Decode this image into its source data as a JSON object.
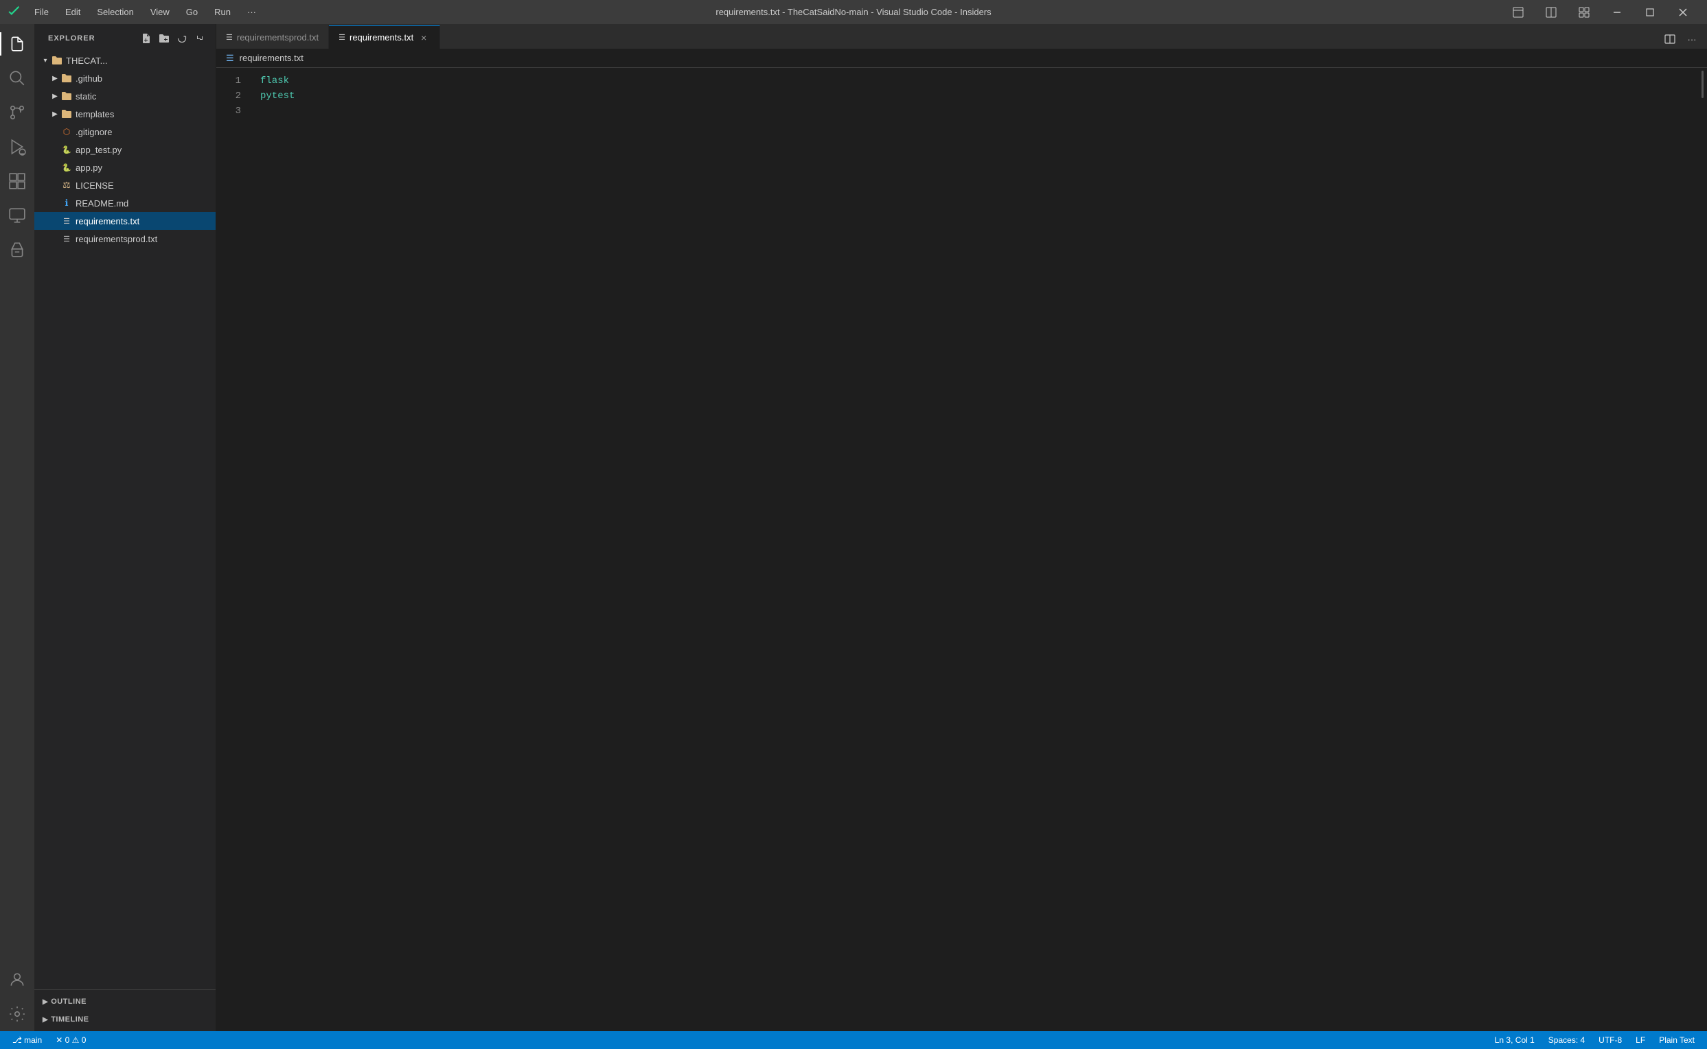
{
  "titlebar": {
    "title": "requirements.txt - TheCatSaidNo-main - Visual Studio Code - Insiders",
    "menu": [
      "File",
      "Edit",
      "Selection",
      "View",
      "Go",
      "Run",
      "···"
    ]
  },
  "activitybar": {
    "items": [
      {
        "name": "explorer",
        "label": "Explorer",
        "active": true
      },
      {
        "name": "search",
        "label": "Search"
      },
      {
        "name": "source-control",
        "label": "Source Control"
      },
      {
        "name": "run-debug",
        "label": "Run and Debug"
      },
      {
        "name": "extensions",
        "label": "Extensions"
      },
      {
        "name": "remote-explorer",
        "label": "Remote Explorer"
      },
      {
        "name": "testing",
        "label": "Testing"
      }
    ],
    "bottom": [
      {
        "name": "accounts",
        "label": "Accounts"
      },
      {
        "name": "settings",
        "label": "Settings"
      }
    ]
  },
  "sidebar": {
    "header": "EXPLORER",
    "root": "THECAT...",
    "files": [
      {
        "type": "folder",
        "name": ".github",
        "indent": 1,
        "expanded": false
      },
      {
        "type": "folder",
        "name": "static",
        "indent": 1,
        "expanded": false
      },
      {
        "type": "folder",
        "name": "templates",
        "indent": 1,
        "expanded": false
      },
      {
        "type": "file",
        "name": ".gitignore",
        "indent": 1,
        "icon": "git"
      },
      {
        "type": "file",
        "name": "app_test.py",
        "indent": 1,
        "icon": "python"
      },
      {
        "type": "file",
        "name": "app.py",
        "indent": 1,
        "icon": "python"
      },
      {
        "type": "file",
        "name": "LICENSE",
        "indent": 1,
        "icon": "license"
      },
      {
        "type": "file",
        "name": "README.md",
        "indent": 1,
        "icon": "info"
      },
      {
        "type": "file",
        "name": "requirements.txt",
        "indent": 1,
        "icon": "txt",
        "selected": true
      },
      {
        "type": "file",
        "name": "requirementsprod.txt",
        "indent": 1,
        "icon": "txt"
      }
    ],
    "outline_label": "OUTLINE",
    "timeline_label": "TIMELINE"
  },
  "tabs": [
    {
      "name": "requirementsprod.txt",
      "active": false,
      "icon": "txt",
      "dirty": false
    },
    {
      "name": "requirements.txt",
      "active": true,
      "icon": "txt",
      "dirty": false,
      "closeable": true
    }
  ],
  "breadcrumb": {
    "filename": "requirements.txt"
  },
  "editor": {
    "lines": [
      {
        "num": 1,
        "content": "flask",
        "color": "keyword"
      },
      {
        "num": 2,
        "content": "pytest",
        "color": "keyword"
      },
      {
        "num": 3,
        "content": "",
        "color": "empty"
      }
    ]
  },
  "statusbar": {
    "branch": "main",
    "errors": "0",
    "warnings": "0",
    "line_col": "Ln 3, Col 1",
    "spaces": "Spaces: 4",
    "encoding": "UTF-8",
    "eol": "LF",
    "language": "Plain Text"
  }
}
